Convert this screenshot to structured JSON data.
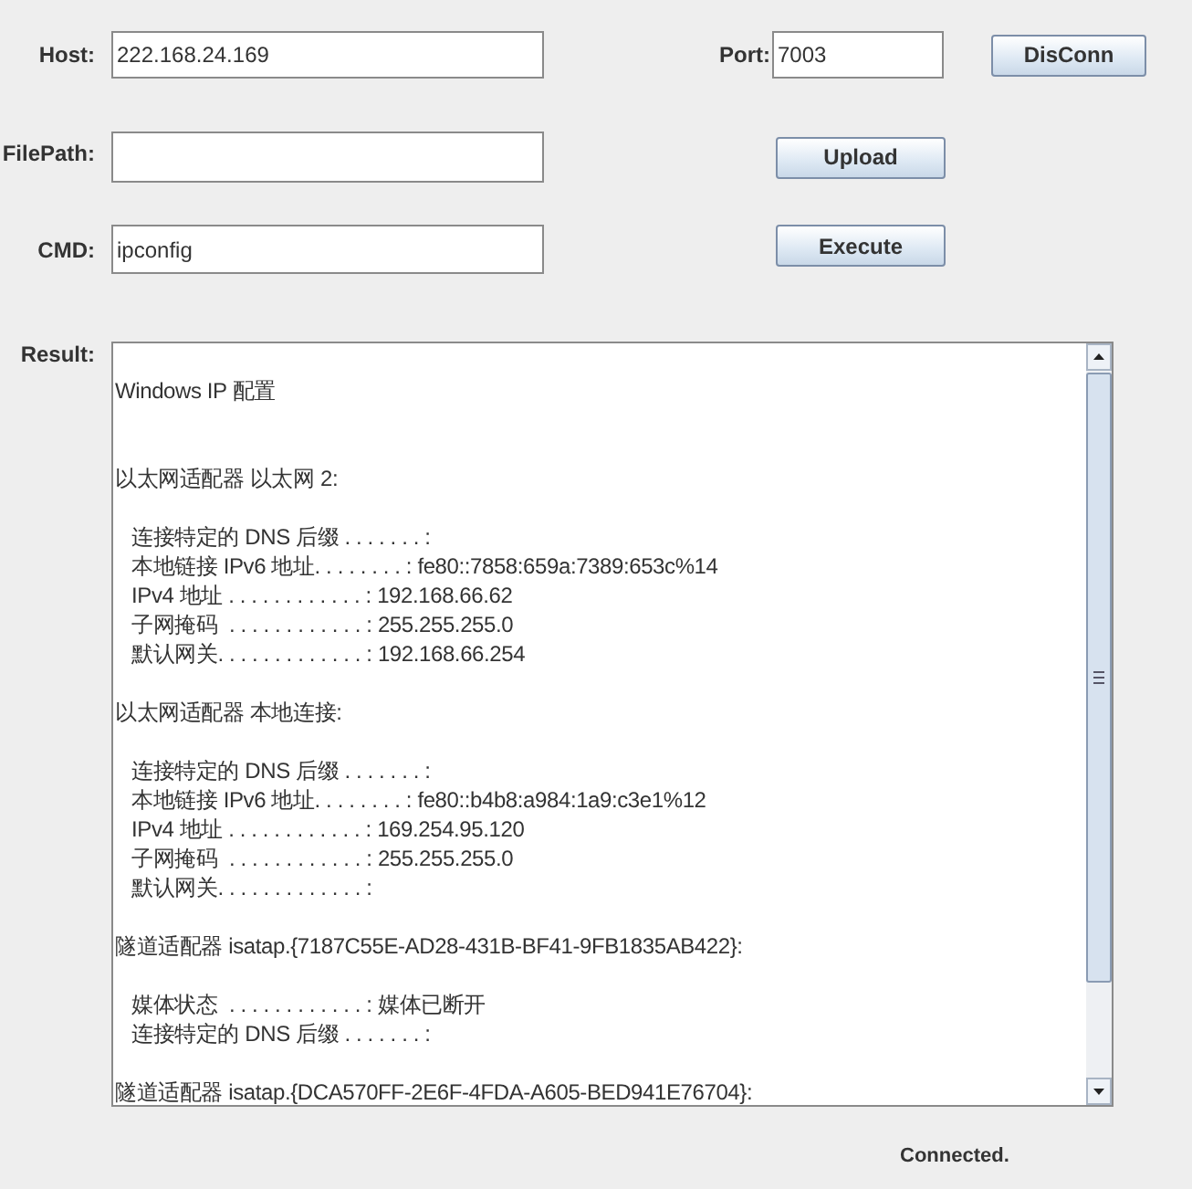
{
  "host": {
    "label": "Host:",
    "value": "222.168.24.169"
  },
  "port": {
    "label": "Port:",
    "value": "7003"
  },
  "disconnect_button": "DisConn",
  "file_path": {
    "label": "FilePath:"
  },
  "upload_button": "Upload",
  "cmd": {
    "label": "CMD:",
    "value": "ipconfig"
  },
  "execute_button": "Execute",
  "result": {
    "label": "Result:",
    "blocks": [
      {
        "kind": "title",
        "lines": [
          "Windows IP 配置"
        ]
      },
      {
        "kind": "section",
        "lines": [
          "以太网适配器 以太网 2:"
        ]
      },
      {
        "kind": "detail",
        "lines": [
          "连接特定的 DNS 后缀 . . . . . . . :",
          "本地链接 IPv6 地址. . . . . . . . : fe80::7858:659a:7389:653c%14",
          "IPv4 地址 . . . . . . . . . . . . : 192.168.66.62",
          "子网掩码  . . . . . . . . . . . . : 255.255.255.0",
          "默认网关. . . . . . . . . . . . . : 192.168.66.254"
        ]
      },
      {
        "kind": "section",
        "lines": [
          "以太网适配器 本地连接:"
        ]
      },
      {
        "kind": "detail",
        "lines": [
          "连接特定的 DNS 后缀 . . . . . . . :",
          "本地链接 IPv6 地址. . . . . . . . : fe80::b4b8:a984:1a9:c3e1%12",
          "IPv4 地址 . . . . . . . . . . . . : 169.254.95.120",
          "子网掩码  . . . . . . . . . . . . : 255.255.255.0",
          "默认网关. . . . . . . . . . . . . :"
        ]
      },
      {
        "kind": "section",
        "lines": [
          "隧道适配器 isatap.{7187C55E-AD28-431B-BF41-9FB1835AB422}:"
        ]
      },
      {
        "kind": "detail",
        "lines": [
          "媒体状态  . . . . . . . . . . . . : 媒体已断开",
          "连接特定的 DNS 后缀 . . . . . . . :"
        ]
      },
      {
        "kind": "section",
        "lines": [
          "隧道适配器 isatap.{DCA570FF-2E6F-4FDA-A605-BED941E76704}:"
        ]
      }
    ]
  },
  "status": "Connected."
}
